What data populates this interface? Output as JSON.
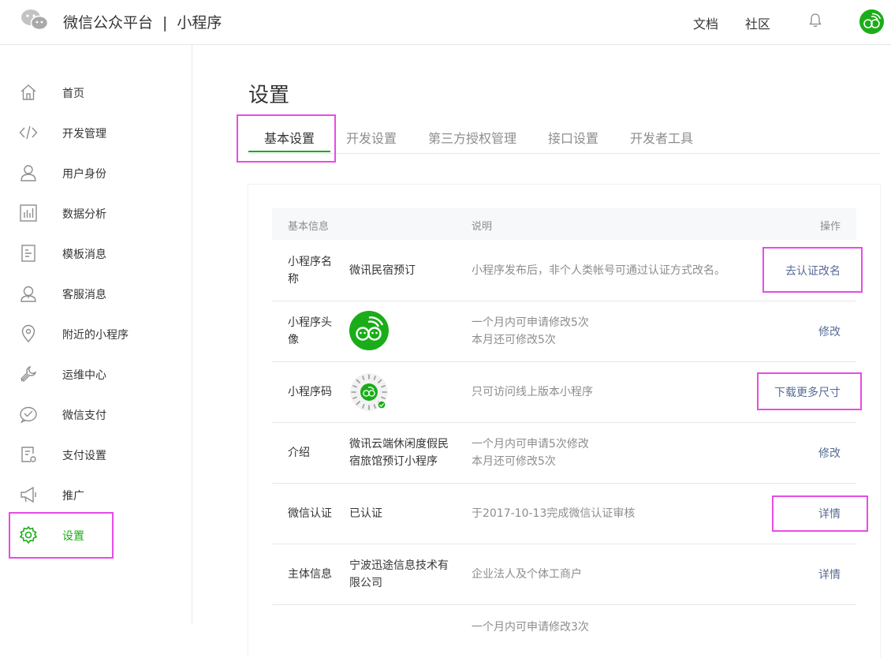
{
  "header": {
    "platform": "微信公众平台",
    "separator": "|",
    "product": "小程序",
    "links": [
      "文档",
      "社区"
    ],
    "icons": [
      "wechat-logo-icon",
      "bell-icon",
      "avatar"
    ]
  },
  "sidebar": {
    "items": [
      {
        "label": "首页",
        "icon": "home-icon"
      },
      {
        "label": "开发管理",
        "icon": "code-icon"
      },
      {
        "label": "用户身份",
        "icon": "user-icon"
      },
      {
        "label": "数据分析",
        "icon": "chart-icon"
      },
      {
        "label": "模板消息",
        "icon": "document-icon"
      },
      {
        "label": "客服消息",
        "icon": "customer-service-icon"
      },
      {
        "label": "附近的小程序",
        "icon": "location-pin-icon"
      },
      {
        "label": "运维中心",
        "icon": "wrench-icon"
      },
      {
        "label": "微信支付",
        "icon": "payment-icon"
      },
      {
        "label": "支付设置",
        "icon": "payment-settings-icon"
      },
      {
        "label": "推广",
        "icon": "megaphone-icon"
      },
      {
        "label": "设置",
        "icon": "gear-icon",
        "active": true
      }
    ]
  },
  "main": {
    "title": "设置",
    "tabs": [
      {
        "label": "基本设置",
        "active": true
      },
      {
        "label": "开发设置"
      },
      {
        "label": "第三方授权管理"
      },
      {
        "label": "接口设置"
      },
      {
        "label": "开发者工具"
      }
    ],
    "table": {
      "headers": [
        "基本信息",
        "说明",
        "操作"
      ],
      "rows": [
        {
          "label_1": "小程序名",
          "label_2": "称",
          "value": "微讯民宿预订",
          "desc_1": "小程序发布后，非个人类帐号可通过认证方式改名。",
          "action": "去认证改名"
        },
        {
          "label_1": "小程序头",
          "label_2": "像",
          "value_image": "mini-program-avatar",
          "desc_1": "一个月内可申请修改5次",
          "desc_2": "本月还可修改5次",
          "action": "修改"
        },
        {
          "label_1": "小程序码",
          "value_image": "mini-program-code",
          "desc_1": "只可访问线上版本小程序",
          "action": "下载更多尺寸"
        },
        {
          "label_1": "介绍",
          "value_1": "微讯云端休闲度假民",
          "value_2": "宿旅馆预订小程序",
          "desc_1": "一个月内可申请5次修改",
          "desc_2": "本月还可修改5次",
          "action": "修改"
        },
        {
          "label_1": "微信认证",
          "value": "已认证",
          "desc_1": "于2017-10-13完成微信认证审核",
          "action": "详情"
        },
        {
          "label_1": "主体信息",
          "value_1": "宁波迅途信息技术有",
          "value_2": "限公司",
          "desc_1": "企业法人及个体工商户",
          "action": "详情"
        }
      ],
      "partial_row": {
        "desc_1": "一个月内可申请修改3次"
      }
    }
  },
  "colors": {
    "accent": "#1aad19",
    "link": "#576b95",
    "highlight": "#e64ce6",
    "muted": "#8d8d8d"
  }
}
